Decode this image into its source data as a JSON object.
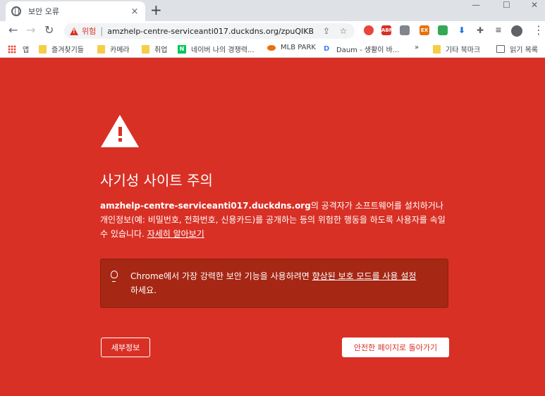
{
  "tab": {
    "title": "보안 오류",
    "close": "×",
    "new_tab": "+"
  },
  "window_controls": {
    "minimize": "—",
    "maximize": "☐",
    "close": "✕"
  },
  "toolbar": {
    "back": "←",
    "forward": "→",
    "reload": "↻",
    "security_label": "위험",
    "url": "amzhelp-centre-serviceanti017.duckdns.org/zpuQIKB",
    "menu": "⋮"
  },
  "extensions": [
    "abp-icon",
    "ext-icon",
    "puzzle-icon",
    "download-icon"
  ],
  "bookmarks": {
    "apps": "앱",
    "items": [
      "즐겨찾기들",
      "카메라",
      "취업",
      "네이버 나의 경쟁력...",
      "MLB PARK",
      "Daum - 생활이 바...",
      "»",
      "기타 북마크",
      "읽기 목록"
    ]
  },
  "page": {
    "heading": "사기성 사이트 주의",
    "site": "amzhelp-centre-serviceanti017.duckdns.org",
    "description": "의 공격자가 소프트웨어를 설치하거나 개인정보(예: 비밀번호, 전화번호, 신용카드)를 공개하는 등의 위험한 행동을 하도록 사용자를 속일 수 있습니다.",
    "learn_more": "자세히 알아보기",
    "tip_prefix": "Chrome에서 가장 강력한 보안 기능을 사용하려면",
    "tip_link": "향상된 보호 모드를 사용 설정",
    "tip_suffix": "하세요.",
    "details_button": "세부정보",
    "back_button": "안전한 페이지로 돌아가기"
  },
  "colors": {
    "danger": "#d93025",
    "tip_box": "#a52714"
  }
}
